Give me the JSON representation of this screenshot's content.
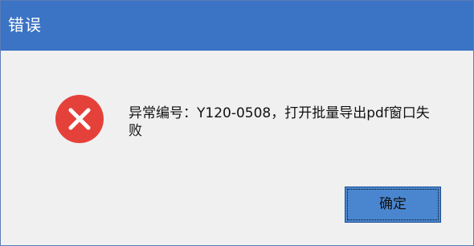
{
  "window": {
    "title": "错误"
  },
  "message": {
    "text": "异常编号：Y120-0508，打开批量导出pdf窗口失败"
  },
  "buttons": {
    "ok_label": "确定"
  },
  "icons": {
    "error": "error-icon"
  },
  "colors": {
    "titlebar": "#3b73c5",
    "dialog_bg": "#f0f0f0",
    "error_red": "#e5413b",
    "button_bg": "#4a86d0"
  }
}
